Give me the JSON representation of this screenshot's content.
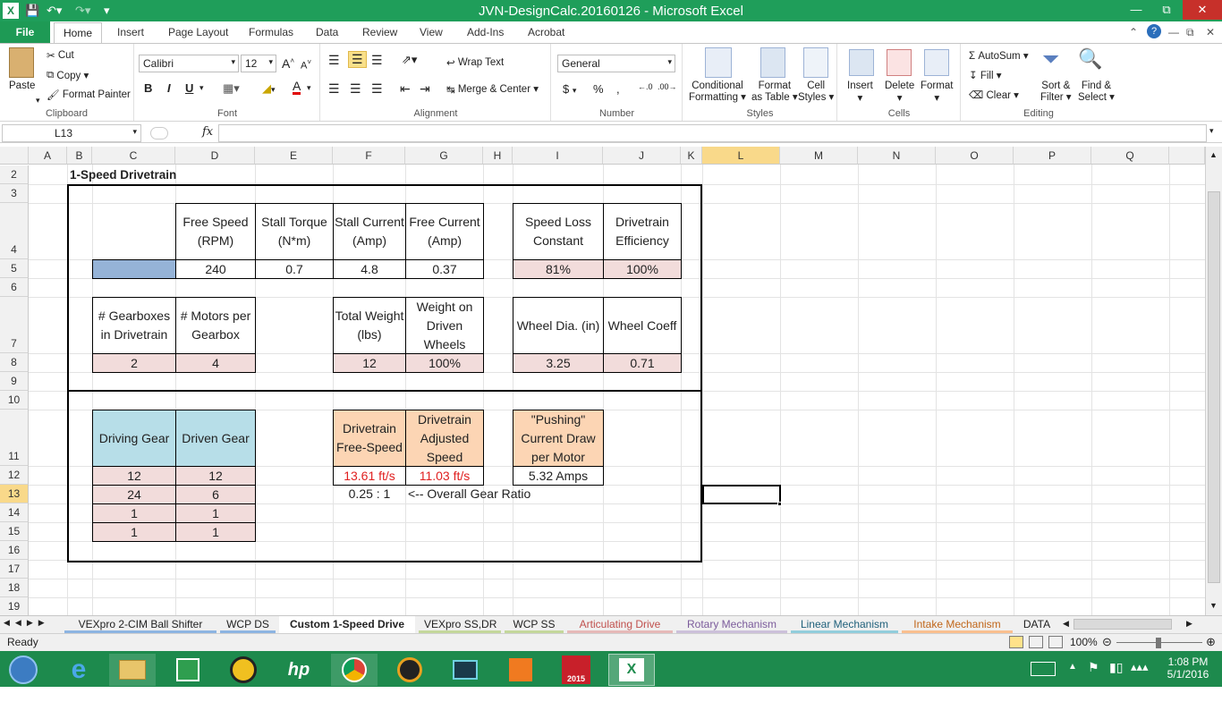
{
  "window": {
    "title": "JVN-DesignCalc.20160126  -  Microsoft Excel"
  },
  "ribbon_tabs": [
    "File",
    "Home",
    "Insert",
    "Page Layout",
    "Formulas",
    "Data",
    "Review",
    "View",
    "Add-Ins",
    "Acrobat"
  ],
  "clipboard": {
    "paste": "Paste",
    "cut": "Cut",
    "copy": "Copy",
    "format_painter": "Format Painter",
    "label": "Clipboard"
  },
  "font": {
    "name": "Calibri",
    "size": "12",
    "label": "Font"
  },
  "alignment": {
    "wrap": "Wrap Text",
    "merge": "Merge & Center",
    "label": "Alignment"
  },
  "number": {
    "format": "General",
    "label": "Number"
  },
  "styles": {
    "conditional": "Conditional",
    "conditional2": "Formatting",
    "format_as": "Format",
    "format_as2": "as Table",
    "cell": "Cell",
    "cell2": "Styles",
    "label": "Styles"
  },
  "cells": {
    "insert": "Insert",
    "delete": "Delete",
    "format": "Format",
    "label": "Cells"
  },
  "editing": {
    "autosum": "AutoSum",
    "fill": "Fill",
    "clear": "Clear",
    "sort": "Sort &",
    "sort2": "Filter",
    "find": "Find &",
    "find2": "Select",
    "label": "Editing"
  },
  "formula_bar": {
    "name_box": "L13",
    "fx": "fx",
    "content": ""
  },
  "columns": [
    "A",
    "B",
    "C",
    "D",
    "E",
    "F",
    "G",
    "H",
    "I",
    "J",
    "K",
    "L",
    "M",
    "N",
    "O",
    "P",
    "Q"
  ],
  "rows": [
    "2",
    "3",
    "4",
    "5",
    "6",
    "7",
    "8",
    "9",
    "10",
    "11",
    "12",
    "13",
    "14",
    "15",
    "16",
    "17",
    "18",
    "19"
  ],
  "sheet": {
    "title": "1-Speed Drivetrain",
    "free_speed_h": "Free Speed (RPM)",
    "stall_torque_h": "Stall Torque (N*m)",
    "stall_current_h": "Stall Current (Amp)",
    "free_current_h": "Free Current (Amp)",
    "speed_loss_h": "Speed Loss Constant",
    "efficiency_h": "Drivetrain Efficiency",
    "free_speed": "240",
    "stall_torque": "0.7",
    "stall_current": "4.8",
    "free_current": "0.37",
    "speed_loss": "81%",
    "efficiency": "100%",
    "gearboxes_h": "# Gearboxes in Drivetrain",
    "motors_h": "# Motors per Gearbox",
    "weight_h": "Total Weight (lbs)",
    "weight_driven_h": "Weight on Driven Wheels",
    "wheel_dia_h": "Wheel Dia. (in)",
    "wheel_coeff_h": "Wheel Coeff",
    "gearboxes": "2",
    "motors": "4",
    "weight": "12",
    "weight_driven": "100%",
    "wheel_dia": "3.25",
    "wheel_coeff": "0.71",
    "driving_h": "Driving Gear",
    "driven_h": "Driven Gear",
    "free_speed_out_h": "Drivetrain Free-Speed",
    "adjusted_h": "Drivetrain Adjusted Speed",
    "pushing_h": "\"Pushing\" Current Draw per Motor",
    "gears": [
      [
        "12",
        "12"
      ],
      [
        "24",
        "6"
      ],
      [
        "1",
        "1"
      ],
      [
        "1",
        "1"
      ]
    ],
    "free_speed_out": "13.61 ft/s",
    "adjusted_out": "11.03 ft/s",
    "pushing_out": "5.32 Amps",
    "ratio": "0.25 : 1",
    "ratio_note": "<-- Overall Gear Ratio"
  },
  "sheet_tabs": [
    {
      "label": "VEXpro 2-CIM Ball Shifter",
      "color": "#8db4e2"
    },
    {
      "label": "WCP DS",
      "color": "#8db4e2"
    },
    {
      "label": "Custom 1-Speed Drive",
      "color": "#ffffff",
      "active": true
    },
    {
      "label": "VEXpro SS,DR",
      "color": "#c4d79b"
    },
    {
      "label": "WCP SS",
      "color": "#c4d79b"
    },
    {
      "label": "Articulating Drive",
      "color": "#e6b9b8"
    },
    {
      "label": "Rotary Mechanism",
      "color": "#ccc0da"
    },
    {
      "label": "Linear Mechanism",
      "color": "#92cddc"
    },
    {
      "label": "Intake Mechanism",
      "color": "#fabf8f"
    },
    {
      "label": "DATA",
      "color": "#ffffff"
    }
  ],
  "status": {
    "ready": "Ready",
    "zoom": "100%"
  },
  "taskbar": {
    "time": "1:08 PM",
    "date": "5/1/2016",
    "sw_label": "2015"
  }
}
